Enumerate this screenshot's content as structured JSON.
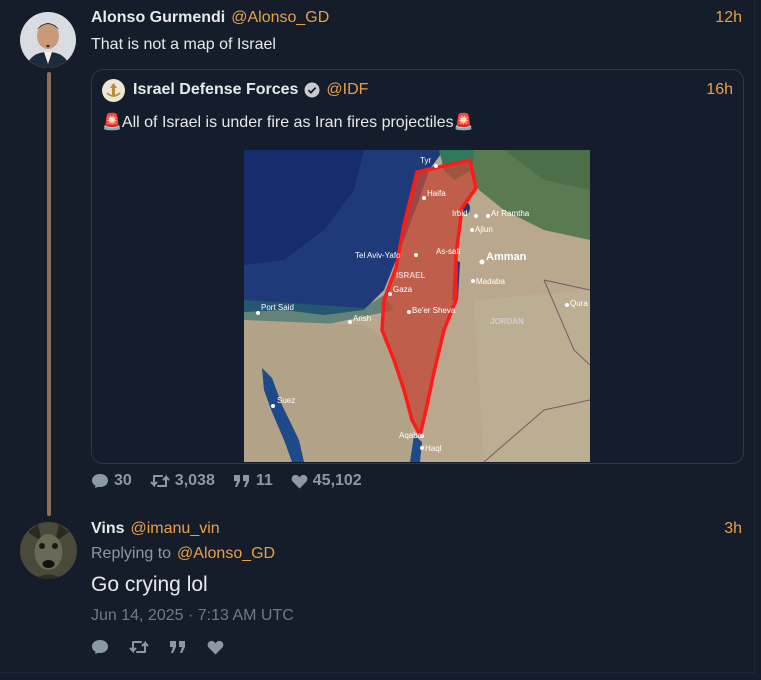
{
  "main_tweet": {
    "author_name": "Alonso Gurmendi",
    "author_handle": "@Alonso_GD",
    "time": "12h",
    "text": "That is not a map of Israel",
    "stats": {
      "replies": "30",
      "retweets": "3,038",
      "quotes": "11",
      "likes": "45,102"
    }
  },
  "quoted_tweet": {
    "author_name": "Israel Defense Forces",
    "author_handle": "@IDF",
    "time": "16h",
    "text": "🚨All of Israel is under fire as Iran fires projectiles🚨",
    "map_labels": {
      "tyr": "Tyr",
      "haifa": "Haifa",
      "irbid": "Irbid",
      "ar_ramtha": "Ar Ramtha",
      "ajlun": "Ajlun",
      "tel_aviv": "Tel Aviv-Yafo",
      "as_salt": "As-salt",
      "amman": "Amman",
      "israel": "ISRAEL",
      "madaba": "Madaba",
      "gaza": "Gaza",
      "port_said": "Port Said",
      "qura": "Qura",
      "arish": "Arish",
      "beer_sheva": "Be'er Sheva",
      "jordan": "JORDAN",
      "suez": "Suez",
      "aqaba": "Aqaba",
      "haql": "Haql"
    }
  },
  "reply": {
    "author_name": "Vins",
    "author_handle": "@imanu_vin",
    "time": "3h",
    "replying_prefix": "Replying to",
    "replying_handle": "@Alonso_GD",
    "text": "Go crying lol",
    "timestamp": "Jun 14, 2025 · 7:13 AM UTC"
  },
  "colors": {
    "accent": "#e8a048",
    "muted": "#8b98a5",
    "thread_line": "#8a7058",
    "israel_outline": "#ff1a1a"
  }
}
